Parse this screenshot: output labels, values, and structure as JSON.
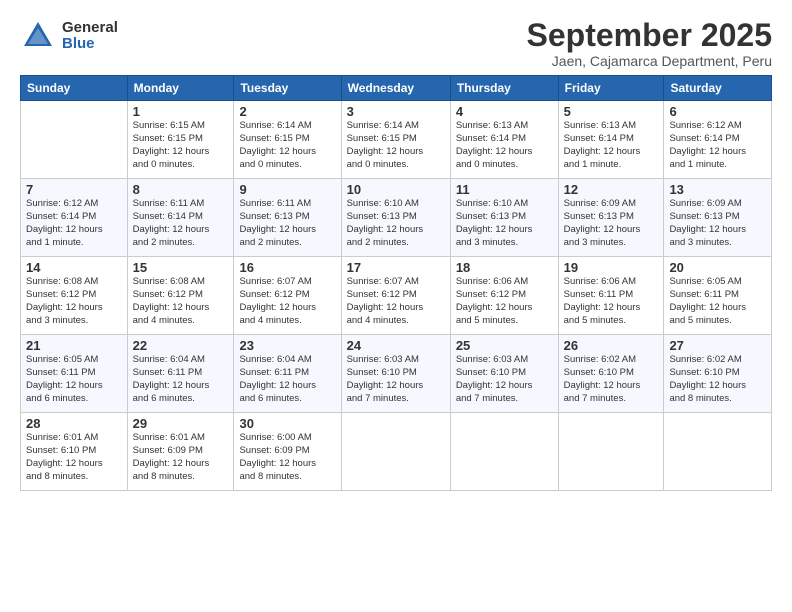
{
  "logo": {
    "general": "General",
    "blue": "Blue"
  },
  "title": "September 2025",
  "subtitle": "Jaen, Cajamarca Department, Peru",
  "headers": [
    "Sunday",
    "Monday",
    "Tuesday",
    "Wednesday",
    "Thursday",
    "Friday",
    "Saturday"
  ],
  "weeks": [
    [
      {
        "day": "",
        "info": ""
      },
      {
        "day": "1",
        "info": "Sunrise: 6:15 AM\nSunset: 6:15 PM\nDaylight: 12 hours\nand 0 minutes."
      },
      {
        "day": "2",
        "info": "Sunrise: 6:14 AM\nSunset: 6:15 PM\nDaylight: 12 hours\nand 0 minutes."
      },
      {
        "day": "3",
        "info": "Sunrise: 6:14 AM\nSunset: 6:15 PM\nDaylight: 12 hours\nand 0 minutes."
      },
      {
        "day": "4",
        "info": "Sunrise: 6:13 AM\nSunset: 6:14 PM\nDaylight: 12 hours\nand 0 minutes."
      },
      {
        "day": "5",
        "info": "Sunrise: 6:13 AM\nSunset: 6:14 PM\nDaylight: 12 hours\nand 1 minute."
      },
      {
        "day": "6",
        "info": "Sunrise: 6:12 AM\nSunset: 6:14 PM\nDaylight: 12 hours\nand 1 minute."
      }
    ],
    [
      {
        "day": "7",
        "info": "Sunrise: 6:12 AM\nSunset: 6:14 PM\nDaylight: 12 hours\nand 1 minute."
      },
      {
        "day": "8",
        "info": "Sunrise: 6:11 AM\nSunset: 6:14 PM\nDaylight: 12 hours\nand 2 minutes."
      },
      {
        "day": "9",
        "info": "Sunrise: 6:11 AM\nSunset: 6:13 PM\nDaylight: 12 hours\nand 2 minutes."
      },
      {
        "day": "10",
        "info": "Sunrise: 6:10 AM\nSunset: 6:13 PM\nDaylight: 12 hours\nand 2 minutes."
      },
      {
        "day": "11",
        "info": "Sunrise: 6:10 AM\nSunset: 6:13 PM\nDaylight: 12 hours\nand 3 minutes."
      },
      {
        "day": "12",
        "info": "Sunrise: 6:09 AM\nSunset: 6:13 PM\nDaylight: 12 hours\nand 3 minutes."
      },
      {
        "day": "13",
        "info": "Sunrise: 6:09 AM\nSunset: 6:13 PM\nDaylight: 12 hours\nand 3 minutes."
      }
    ],
    [
      {
        "day": "14",
        "info": "Sunrise: 6:08 AM\nSunset: 6:12 PM\nDaylight: 12 hours\nand 3 minutes."
      },
      {
        "day": "15",
        "info": "Sunrise: 6:08 AM\nSunset: 6:12 PM\nDaylight: 12 hours\nand 4 minutes."
      },
      {
        "day": "16",
        "info": "Sunrise: 6:07 AM\nSunset: 6:12 PM\nDaylight: 12 hours\nand 4 minutes."
      },
      {
        "day": "17",
        "info": "Sunrise: 6:07 AM\nSunset: 6:12 PM\nDaylight: 12 hours\nand 4 minutes."
      },
      {
        "day": "18",
        "info": "Sunrise: 6:06 AM\nSunset: 6:12 PM\nDaylight: 12 hours\nand 5 minutes."
      },
      {
        "day": "19",
        "info": "Sunrise: 6:06 AM\nSunset: 6:11 PM\nDaylight: 12 hours\nand 5 minutes."
      },
      {
        "day": "20",
        "info": "Sunrise: 6:05 AM\nSunset: 6:11 PM\nDaylight: 12 hours\nand 5 minutes."
      }
    ],
    [
      {
        "day": "21",
        "info": "Sunrise: 6:05 AM\nSunset: 6:11 PM\nDaylight: 12 hours\nand 6 minutes."
      },
      {
        "day": "22",
        "info": "Sunrise: 6:04 AM\nSunset: 6:11 PM\nDaylight: 12 hours\nand 6 minutes."
      },
      {
        "day": "23",
        "info": "Sunrise: 6:04 AM\nSunset: 6:11 PM\nDaylight: 12 hours\nand 6 minutes."
      },
      {
        "day": "24",
        "info": "Sunrise: 6:03 AM\nSunset: 6:10 PM\nDaylight: 12 hours\nand 7 minutes."
      },
      {
        "day": "25",
        "info": "Sunrise: 6:03 AM\nSunset: 6:10 PM\nDaylight: 12 hours\nand 7 minutes."
      },
      {
        "day": "26",
        "info": "Sunrise: 6:02 AM\nSunset: 6:10 PM\nDaylight: 12 hours\nand 7 minutes."
      },
      {
        "day": "27",
        "info": "Sunrise: 6:02 AM\nSunset: 6:10 PM\nDaylight: 12 hours\nand 8 minutes."
      }
    ],
    [
      {
        "day": "28",
        "info": "Sunrise: 6:01 AM\nSunset: 6:10 PM\nDaylight: 12 hours\nand 8 minutes."
      },
      {
        "day": "29",
        "info": "Sunrise: 6:01 AM\nSunset: 6:09 PM\nDaylight: 12 hours\nand 8 minutes."
      },
      {
        "day": "30",
        "info": "Sunrise: 6:00 AM\nSunset: 6:09 PM\nDaylight: 12 hours\nand 8 minutes."
      },
      {
        "day": "",
        "info": ""
      },
      {
        "day": "",
        "info": ""
      },
      {
        "day": "",
        "info": ""
      },
      {
        "day": "",
        "info": ""
      }
    ]
  ]
}
